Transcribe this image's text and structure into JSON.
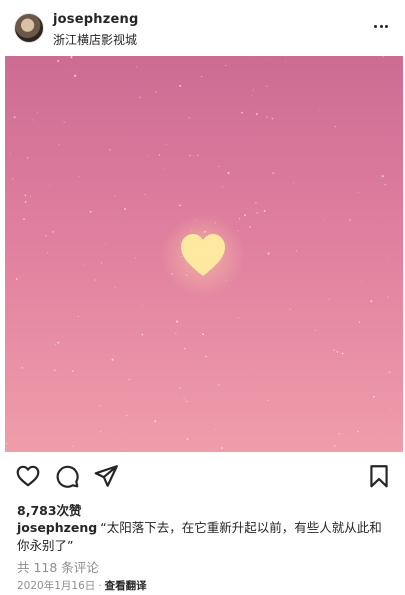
{
  "post": {
    "username": "josephzeng",
    "location": "浙江横店影视城",
    "likes": "8,783次赞",
    "caption_user": "josephzeng",
    "caption_text": "“太阳落下去，在它重新升起以前，有些人就从此和你永别了”",
    "comments": "共 118 条评论",
    "date": "2020年1月16日",
    "separator": "·",
    "translate": "查看翻译"
  },
  "icons": {
    "more": "more-horizontal-icon",
    "like": "heart-outline-icon",
    "comment": "comment-bubble-icon",
    "share": "paper-plane-icon",
    "save": "bookmark-icon"
  },
  "colors": {
    "text": "#262626",
    "secondary": "#8e8e8e",
    "sky_top": "#cf6f95",
    "sky_bottom": "#ee9aa8",
    "heart": "#ffe9a3"
  }
}
